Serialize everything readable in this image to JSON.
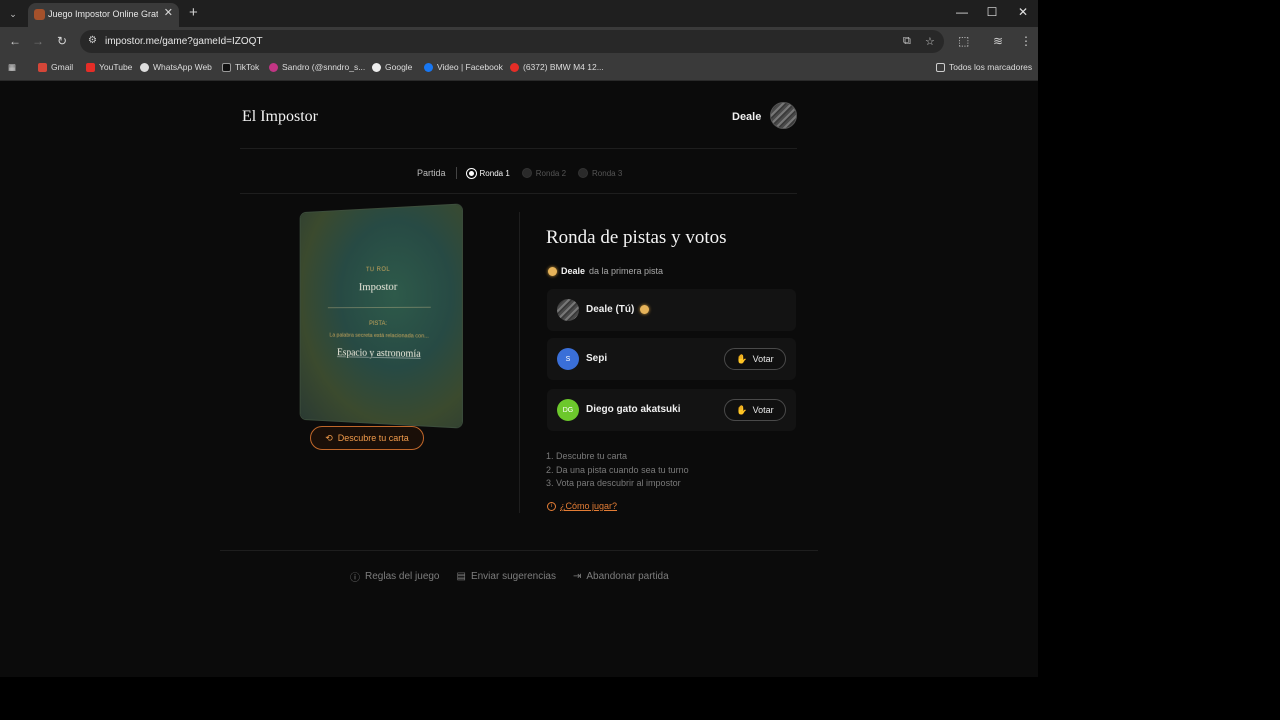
{
  "browser": {
    "tab_title": "Juego Impostor Online Gratis -",
    "url": "impostor.me/game?gameId=IZOQT",
    "bookmarks": [
      "Gmail",
      "YouTube",
      "WhatsApp Web",
      "TikTok",
      "Sandro (@snndro_s...",
      "Google",
      "Video | Facebook",
      "(6372) BMW M4 12..."
    ],
    "all_bookmarks": "Todos los marcadores"
  },
  "header": {
    "logo": "El Impostor",
    "user": "Deale"
  },
  "rounds": {
    "partida": "Partida",
    "items": [
      "Ronda 1",
      "Ronda 2",
      "Ronda 3"
    ],
    "active": 0
  },
  "card": {
    "tu_rol": "TU ROL",
    "role": "Impostor",
    "pista_label": "PISTA:",
    "pista_sub": "La palabra secreta está relacionada con...",
    "word": "Espacio y astronomía",
    "reveal_button": "Descubre tu carta"
  },
  "panel": {
    "title": "Ronda de pistas y votos",
    "clue_name": "Deale",
    "clue_text": "da la primera pista",
    "players": [
      {
        "name": "Deale (Tú)",
        "initials": "",
        "color": "#6a6a6a",
        "vote": ""
      },
      {
        "name": "Sepi",
        "initials": "S",
        "color": "#3a6fd8",
        "vote": "Votar"
      },
      {
        "name": "Diego gato akatsuki",
        "initials": "DG",
        "color": "#6cc82c",
        "vote": "Votar"
      }
    ],
    "steps": [
      "1. Descubre tu carta",
      "2. Da una pista cuando sea tu turno",
      "3. Vota para descubrir al impostor"
    ],
    "howto": "¿Cómo jugar?"
  },
  "footer": {
    "rules": "Reglas del juego",
    "suggest": "Enviar sugerencias",
    "leave": "Abandonar partida"
  },
  "colors": {
    "accent": "#e47d35",
    "background": "#0b0b0b"
  }
}
